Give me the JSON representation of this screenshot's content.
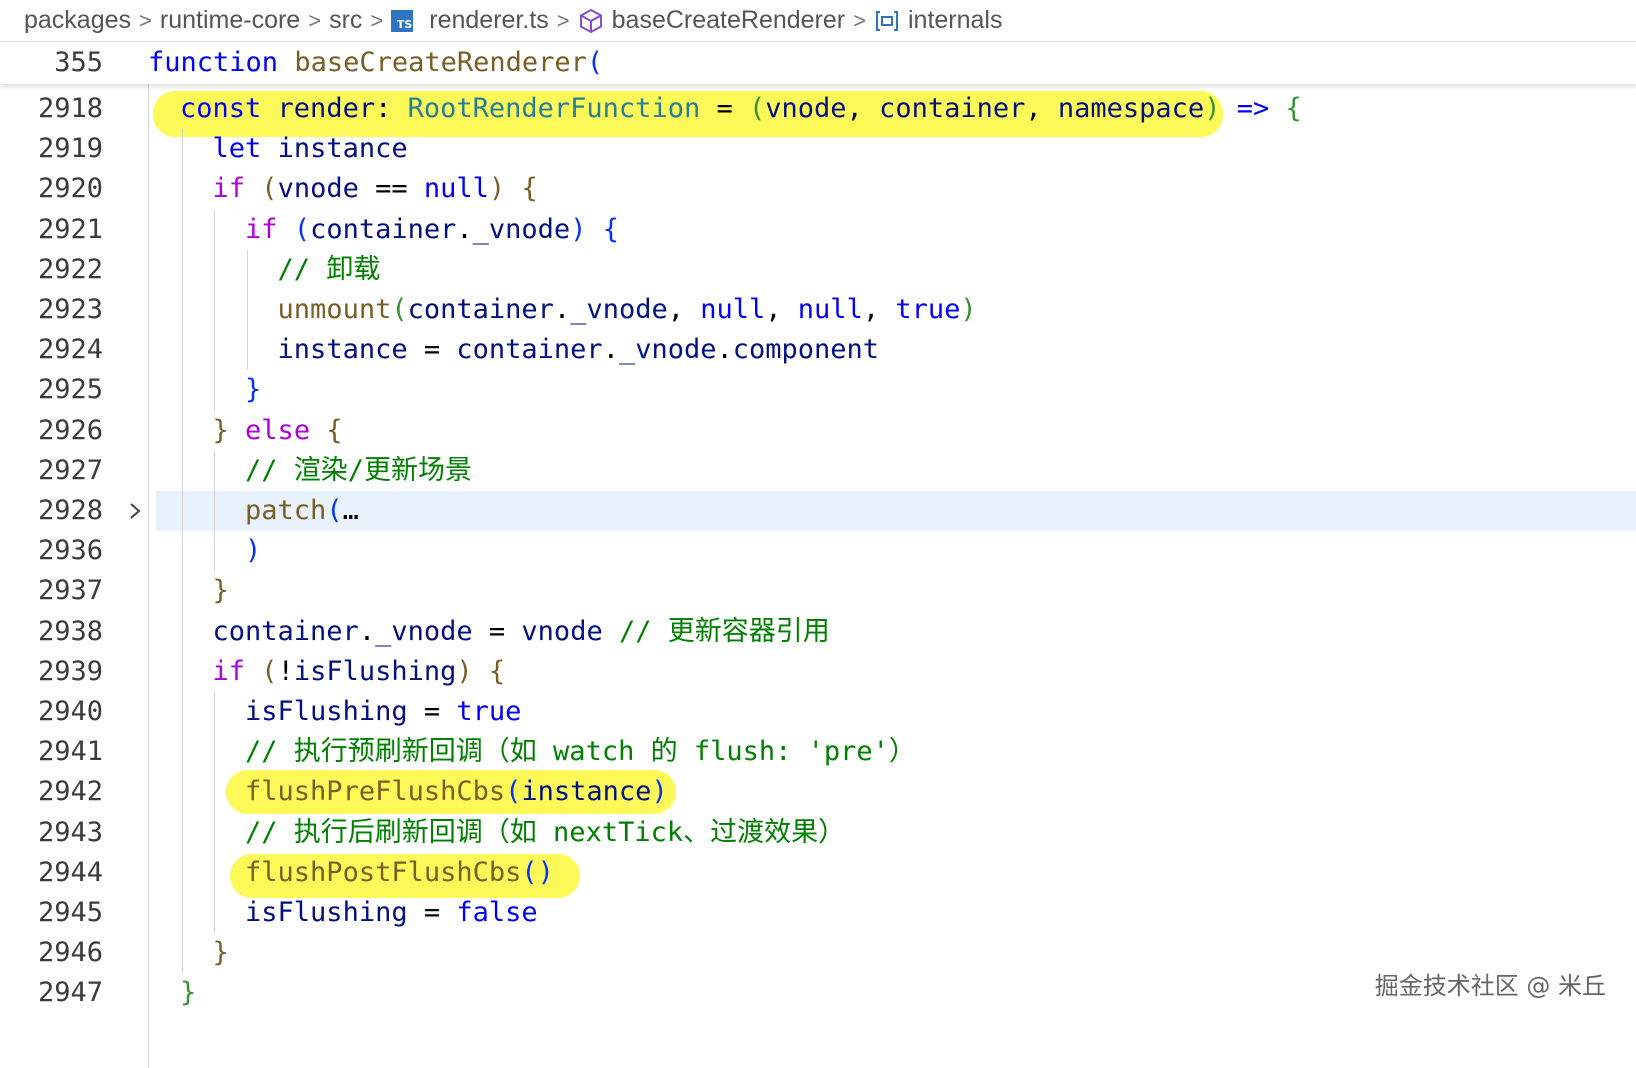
{
  "breadcrumb": {
    "items": [
      "packages",
      "runtime-core",
      "src",
      "renderer.ts",
      "baseCreateRenderer",
      "internals"
    ],
    "separator": ">"
  },
  "sticky": {
    "line_number": "355",
    "keyword": "function",
    "name": "baseCreateRenderer",
    "paren": "("
  },
  "lines": [
    {
      "n": "2918",
      "tokens": [
        [
          "const",
          "kw"
        ],
        [
          " ",
          ""
        ],
        [
          "render",
          "var"
        ],
        [
          ": ",
          "op"
        ],
        [
          "RootRenderFunction",
          "ty"
        ],
        [
          " = ",
          "op"
        ],
        [
          "(",
          "p3"
        ],
        [
          "vnode",
          "var"
        ],
        [
          ", ",
          "op"
        ],
        [
          "container",
          "var"
        ],
        [
          ", ",
          "op"
        ],
        [
          "namespace",
          "var"
        ],
        [
          ")",
          "p3"
        ],
        [
          " ",
          "op"
        ],
        [
          "=>",
          "kw"
        ],
        [
          " ",
          "op"
        ],
        [
          "{",
          "p3"
        ]
      ]
    },
    {
      "n": "2919",
      "tokens": [
        [
          "  ",
          ""
        ],
        [
          "let",
          "kw"
        ],
        [
          " ",
          ""
        ],
        [
          "instance",
          "var"
        ]
      ]
    },
    {
      "n": "2920",
      "tokens": [
        [
          "  ",
          ""
        ],
        [
          "if",
          "kw2"
        ],
        [
          " ",
          ""
        ],
        [
          "(",
          "p1"
        ],
        [
          "vnode",
          "var"
        ],
        [
          " == ",
          "op"
        ],
        [
          "null",
          "kw"
        ],
        [
          ")",
          "p1"
        ],
        [
          " ",
          ""
        ],
        [
          "{",
          "p1"
        ]
      ]
    },
    {
      "n": "2921",
      "tokens": [
        [
          "    ",
          ""
        ],
        [
          "if",
          "kw2"
        ],
        [
          " ",
          ""
        ],
        [
          "(",
          "p2"
        ],
        [
          "container",
          "var"
        ],
        [
          ".",
          "op"
        ],
        [
          "_vnode",
          "var"
        ],
        [
          ")",
          "p2"
        ],
        [
          " ",
          ""
        ],
        [
          "{",
          "p2"
        ]
      ]
    },
    {
      "n": "2922",
      "tokens": [
        [
          "      ",
          ""
        ],
        [
          "// 卸载",
          "cm"
        ]
      ]
    },
    {
      "n": "2923",
      "tokens": [
        [
          "      ",
          ""
        ],
        [
          "unmount",
          "fn"
        ],
        [
          "(",
          "p3"
        ],
        [
          "container",
          "var"
        ],
        [
          ".",
          "op"
        ],
        [
          "_vnode",
          "var"
        ],
        [
          ", ",
          "op"
        ],
        [
          "null",
          "kw"
        ],
        [
          ", ",
          "op"
        ],
        [
          "null",
          "kw"
        ],
        [
          ", ",
          "op"
        ],
        [
          "true",
          "kw"
        ],
        [
          ")",
          "p3"
        ]
      ]
    },
    {
      "n": "2924",
      "tokens": [
        [
          "      ",
          ""
        ],
        [
          "instance",
          "var"
        ],
        [
          " = ",
          "op"
        ],
        [
          "container",
          "var"
        ],
        [
          ".",
          "op"
        ],
        [
          "_vnode",
          "var"
        ],
        [
          ".",
          "op"
        ],
        [
          "component",
          "var"
        ]
      ]
    },
    {
      "n": "2925",
      "tokens": [
        [
          "    ",
          ""
        ],
        [
          "}",
          "p2"
        ]
      ]
    },
    {
      "n": "2926",
      "tokens": [
        [
          "  ",
          ""
        ],
        [
          "}",
          "p1"
        ],
        [
          " ",
          ""
        ],
        [
          "else",
          "kw2"
        ],
        [
          " ",
          ""
        ],
        [
          "{",
          "p1"
        ]
      ]
    },
    {
      "n": "2927",
      "tokens": [
        [
          "    ",
          ""
        ],
        [
          "// 渲染/更新场景",
          "cm"
        ]
      ]
    },
    {
      "n": "2928",
      "tokens": [
        [
          "    ",
          ""
        ],
        [
          "patch",
          "fn"
        ],
        [
          "(",
          "p2"
        ],
        [
          "…",
          "op"
        ]
      ],
      "folded": true
    },
    {
      "n": "2936",
      "tokens": [
        [
          "    ",
          ""
        ],
        [
          ")",
          "p2"
        ]
      ]
    },
    {
      "n": "2937",
      "tokens": [
        [
          "  ",
          ""
        ],
        [
          "}",
          "p1"
        ]
      ]
    },
    {
      "n": "2938",
      "tokens": [
        [
          "  ",
          ""
        ],
        [
          "container",
          "var"
        ],
        [
          ".",
          "op"
        ],
        [
          "_vnode",
          "var"
        ],
        [
          " = ",
          "op"
        ],
        [
          "vnode",
          "var"
        ],
        [
          " ",
          ""
        ],
        [
          "// 更新容器引用",
          "cm"
        ]
      ]
    },
    {
      "n": "2939",
      "tokens": [
        [
          "  ",
          ""
        ],
        [
          "if",
          "kw2"
        ],
        [
          " ",
          ""
        ],
        [
          "(",
          "p1"
        ],
        [
          "!",
          "op"
        ],
        [
          "isFlushing",
          "var"
        ],
        [
          ")",
          "p1"
        ],
        [
          " ",
          ""
        ],
        [
          "{",
          "p1"
        ]
      ]
    },
    {
      "n": "2940",
      "tokens": [
        [
          "    ",
          ""
        ],
        [
          "isFlushing",
          "var"
        ],
        [
          " = ",
          "op"
        ],
        [
          "true",
          "kw"
        ]
      ]
    },
    {
      "n": "2941",
      "tokens": [
        [
          "    ",
          ""
        ],
        [
          "// 执行预刷新回调（如 watch 的 flush: 'pre'）",
          "cm"
        ]
      ]
    },
    {
      "n": "2942",
      "tokens": [
        [
          "    ",
          ""
        ],
        [
          "flushPreFlushCbs",
          "fn"
        ],
        [
          "(",
          "p2"
        ],
        [
          "instance",
          "var"
        ],
        [
          ")",
          "p2"
        ]
      ]
    },
    {
      "n": "2943",
      "tokens": [
        [
          "    ",
          ""
        ],
        [
          "// 执行后刷新回调（如 nextTick、过渡效果）",
          "cm"
        ]
      ]
    },
    {
      "n": "2944",
      "tokens": [
        [
          "    ",
          ""
        ],
        [
          "flushPostFlushCbs",
          "fn"
        ],
        [
          "()",
          "p2"
        ]
      ]
    },
    {
      "n": "2945",
      "tokens": [
        [
          "    ",
          ""
        ],
        [
          "isFlushing",
          "var"
        ],
        [
          " = ",
          "op"
        ],
        [
          "false",
          "kw"
        ]
      ]
    },
    {
      "n": "2946",
      "tokens": [
        [
          "  ",
          ""
        ],
        [
          "}",
          "p1"
        ]
      ]
    },
    {
      "n": "2947",
      "tokens": [
        [
          "}",
          "p3"
        ]
      ]
    }
  ],
  "watermark": "掘金技术社区 @ 米丘",
  "colors": {
    "highlight_marker": "#fdf84a",
    "folded_line_bg": "#e8f1fc",
    "keyword": "#0000ff",
    "control": "#af00db",
    "function": "#795e26",
    "type": "#267f99",
    "variable": "#001080",
    "comment": "#008000"
  }
}
